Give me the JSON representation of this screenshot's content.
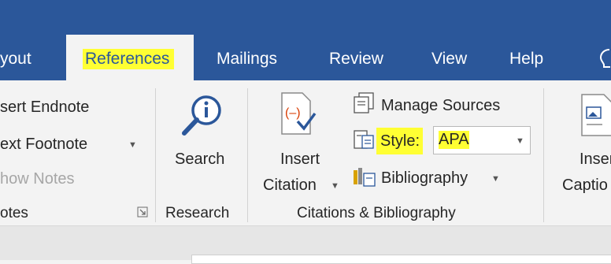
{
  "tabs": {
    "layout_partial": "yout",
    "references": "References",
    "mailings": "Mailings",
    "review": "Review",
    "view": "View",
    "help": "Help"
  },
  "footnotes_group": {
    "insert_endnote": "sert Endnote",
    "next_footnote": "ext Footnote",
    "show_notes": "how Notes",
    "label": "otes"
  },
  "research_group": {
    "search": "Search",
    "label": "Research"
  },
  "citations_group": {
    "insert_citation_line1": "Insert",
    "insert_citation_line2": "Citation",
    "manage_sources": "Manage Sources",
    "style_label": "Style:",
    "style_value": "APA",
    "bibliography": "Bibliography",
    "label": "Citations & Bibliography"
  },
  "captions_group": {
    "insert_caption_line1": "Inser",
    "insert_caption_line2": "Captio"
  },
  "colors": {
    "tabbar": "#2b579a",
    "highlight": "#ffff33",
    "ribbon": "#f3f3f3"
  },
  "icons": [
    "search-magnifier-icon",
    "insert-citation-icon",
    "manage-sources-icon",
    "style-icon",
    "bibliography-icon",
    "insert-caption-icon",
    "tell-me-lightbulb-icon",
    "dialog-launcher-icon"
  ]
}
